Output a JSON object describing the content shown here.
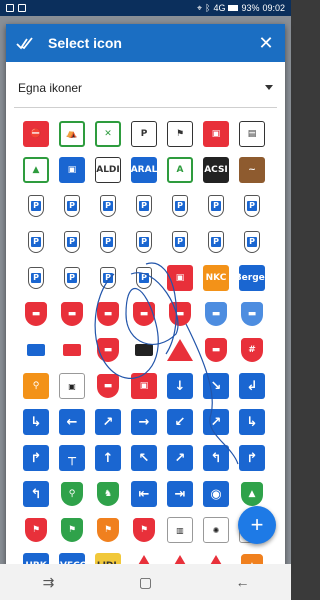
{
  "status": {
    "battery": "93%",
    "time": "09:02",
    "network": "4G"
  },
  "dialog": {
    "title": "Select icon",
    "close_glyph": "✕"
  },
  "dropdown": {
    "selected": "Egna ikoner"
  },
  "grid": {
    "icons": [
      {
        "name": "no-entry-icon",
        "cls": "red",
        "glyph": "⛔"
      },
      {
        "name": "camping-tent-icon",
        "cls": "green-tri",
        "glyph": "⛺"
      },
      {
        "name": "picnic-icon",
        "cls": "green-tri",
        "glyph": "✕"
      },
      {
        "name": "parking-caravan-icon",
        "cls": "outline",
        "glyph": "P"
      },
      {
        "name": "caravan-service-icon",
        "cls": "outline",
        "glyph": "⚑"
      },
      {
        "name": "motorhome-red-icon",
        "cls": "red",
        "glyph": "▣"
      },
      {
        "name": "motorhome-sign-icon",
        "cls": "outline",
        "glyph": "▤"
      },
      {
        "name": "camping-sign-icon",
        "cls": "green-tri",
        "glyph": "▲"
      },
      {
        "name": "motorhome-blue-icon",
        "cls": "blue",
        "glyph": "▣"
      },
      {
        "name": "aldi-icon",
        "cls": "outline",
        "glyph": "ALDI"
      },
      {
        "name": "aral-icon",
        "cls": "blue",
        "glyph": "ARAL"
      },
      {
        "name": "a-sign-icon",
        "cls": "green-tri",
        "glyph": "A"
      },
      {
        "name": "acsi-icon",
        "cls": "black",
        "glyph": "ACSI"
      },
      {
        "name": "brown-sign-icon",
        "cls": "brown",
        "glyph": "~"
      },
      {
        "name": "parking-pin-icon",
        "cls": "pinP",
        "glyph": "P"
      },
      {
        "name": "parking-pin-icon",
        "cls": "pinP",
        "glyph": "P"
      },
      {
        "name": "parking-pin-icon",
        "cls": "pinP",
        "glyph": "P"
      },
      {
        "name": "parking-pin-icon",
        "cls": "pinP",
        "glyph": "P"
      },
      {
        "name": "parking-pin-icon",
        "cls": "pinP",
        "glyph": "P"
      },
      {
        "name": "parking-pin-icon",
        "cls": "pinP",
        "glyph": "P"
      },
      {
        "name": "parking-pin-icon",
        "cls": "pinP",
        "glyph": "P"
      },
      {
        "name": "parking-pin-icon",
        "cls": "pinP",
        "glyph": "P"
      },
      {
        "name": "parking-pin-icon",
        "cls": "pinP",
        "glyph": "P"
      },
      {
        "name": "parking-pin-icon",
        "cls": "pinP",
        "glyph": "P"
      },
      {
        "name": "parking-pin-icon",
        "cls": "pinP",
        "glyph": "P"
      },
      {
        "name": "parking-pin-icon",
        "cls": "pinP",
        "glyph": "P"
      },
      {
        "name": "parking-pin-icon",
        "cls": "pinP",
        "glyph": "P"
      },
      {
        "name": "parking-pin-icon",
        "cls": "pinP",
        "glyph": "P"
      },
      {
        "name": "parking-pin-icon",
        "cls": "pinP",
        "glyph": "P"
      },
      {
        "name": "parking-pin-icon",
        "cls": "pinP",
        "glyph": "P"
      },
      {
        "name": "parking-pin-icon",
        "cls": "pinP",
        "glyph": "P"
      },
      {
        "name": "parking-pin-icon",
        "cls": "pinP",
        "glyph": "P"
      },
      {
        "name": "motorhome-red-big-icon",
        "cls": "red",
        "glyph": "▣"
      },
      {
        "name": "nkc-icon",
        "cls": "orange",
        "glyph": "NKC"
      },
      {
        "name": "berger-icon",
        "cls": "blue",
        "glyph": "Berger"
      },
      {
        "name": "motorhome-marker-red-icon",
        "cls": "markerR",
        "glyph": "▬"
      },
      {
        "name": "motorhome-marker-red-icon",
        "cls": "markerR",
        "glyph": "▬"
      },
      {
        "name": "motorhome-marker-red-icon",
        "cls": "markerR",
        "glyph": "▬"
      },
      {
        "name": "motorhome-marker-red-icon",
        "cls": "markerR",
        "glyph": "▬"
      },
      {
        "name": "motorhome-marker-red-icon",
        "cls": "markerR",
        "glyph": "▬"
      },
      {
        "name": "motorhome-marker-blue-icon",
        "cls": "markerB",
        "glyph": "▬"
      },
      {
        "name": "motorhome-marker-blue-icon",
        "cls": "markerB",
        "glyph": "▬"
      },
      {
        "name": "motorhome-small-blue-icon",
        "cls": "small",
        "glyph": ""
      },
      {
        "name": "motorhome-small-red-icon",
        "cls": "smallR",
        "glyph": ""
      },
      {
        "name": "motorhome-marker-red-icon",
        "cls": "markerR",
        "glyph": "▬"
      },
      {
        "name": "motorhome-small-black-icon",
        "cls": "smallK",
        "glyph": ""
      },
      {
        "name": "warning-sign-icon",
        "cls": "warn",
        "glyph": ""
      },
      {
        "name": "motorhome-marker-red-icon",
        "cls": "markerR",
        "glyph": "▬"
      },
      {
        "name": "fence-marker-red-icon",
        "cls": "markerR",
        "glyph": "#"
      },
      {
        "name": "cycling-icon",
        "cls": "orange",
        "glyph": "⚲"
      },
      {
        "name": "car-wreck-icon",
        "cls": "text",
        "glyph": "▣"
      },
      {
        "name": "motorhome-accident-icon",
        "cls": "markerR",
        "glyph": "▬"
      },
      {
        "name": "motorhome-sign-red-icon",
        "cls": "red",
        "glyph": "▣"
      },
      {
        "name": "arrow-down-icon",
        "cls": "blue-sign",
        "glyph": "↓"
      },
      {
        "name": "arrow-down-right-icon",
        "cls": "blue-sign",
        "glyph": "↘"
      },
      {
        "name": "turn-left-down-icon",
        "cls": "blue-sign",
        "glyph": "↲"
      },
      {
        "name": "turn-right-down-icon",
        "cls": "blue-sign",
        "glyph": "↳"
      },
      {
        "name": "arrow-left-icon",
        "cls": "blue-sign",
        "glyph": "←"
      },
      {
        "name": "arrow-up-right-icon",
        "cls": "blue-sign",
        "glyph": "↗"
      },
      {
        "name": "arrow-right-icon",
        "cls": "blue-sign",
        "glyph": "→"
      },
      {
        "name": "arrow-down-left-icon",
        "cls": "blue-sign",
        "glyph": "↙"
      },
      {
        "name": "arrow-up-right-icon",
        "cls": "blue-sign",
        "glyph": "↗"
      },
      {
        "name": "turn-right-down-icon",
        "cls": "blue-sign",
        "glyph": "↳"
      },
      {
        "name": "turn-up-right-icon",
        "cls": "blue-sign",
        "glyph": "↱"
      },
      {
        "name": "junction-t-icon",
        "cls": "blue-sign",
        "glyph": "┬"
      },
      {
        "name": "arrow-up-icon",
        "cls": "blue-sign",
        "glyph": "↑"
      },
      {
        "name": "arrow-up-left-icon",
        "cls": "blue-sign",
        "glyph": "↖"
      },
      {
        "name": "arrow-up-right-icon",
        "cls": "blue-sign",
        "glyph": "↗"
      },
      {
        "name": "turn-left-up-icon",
        "cls": "blue-sign",
        "glyph": "↰"
      },
      {
        "name": "turn-up-right-icon",
        "cls": "blue-sign",
        "glyph": "↱"
      },
      {
        "name": "return-icon",
        "cls": "blue-sign",
        "glyph": "↰"
      },
      {
        "name": "hiking-icon",
        "cls": "markerG",
        "glyph": "⚲"
      },
      {
        "name": "horse-icon",
        "cls": "markerG",
        "glyph": "♞"
      },
      {
        "name": "exit-left-icon",
        "cls": "blue-sign",
        "glyph": "⇤"
      },
      {
        "name": "exit-right-icon",
        "cls": "blue-sign",
        "glyph": "⇥"
      },
      {
        "name": "camera-icon",
        "cls": "blue-sign",
        "glyph": "◉"
      },
      {
        "name": "mountain-marker-icon",
        "cls": "markerG",
        "glyph": "▲"
      },
      {
        "name": "finish-red-icon",
        "cls": "markerR",
        "glyph": "⚑"
      },
      {
        "name": "finish-green-icon",
        "cls": "markerG",
        "glyph": "⚑"
      },
      {
        "name": "finish-orange-icon",
        "cls": "markerO",
        "glyph": "⚑"
      },
      {
        "name": "finish-red-icon",
        "cls": "markerR",
        "glyph": "⚑"
      },
      {
        "name": "gas-cylinder-icon",
        "cls": "text",
        "glyph": "▥"
      },
      {
        "name": "sunflower-icon",
        "cls": "text",
        "glyph": "✺"
      },
      {
        "name": "blank-icon",
        "cls": "text",
        "glyph": ""
      },
      {
        "name": "hbk-icon",
        "cls": "blue",
        "glyph": "HBK"
      },
      {
        "name": "iveco-icon",
        "cls": "blue",
        "glyph": "IVECO"
      },
      {
        "name": "lidl-icon",
        "cls": "yellow",
        "glyph": "LIDL"
      },
      {
        "name": "warning-triangle-icon",
        "cls": "warn",
        "glyph": ""
      },
      {
        "name": "warning-triangle-icon",
        "cls": "warn",
        "glyph": ""
      },
      {
        "name": "warning-triangle-icon",
        "cls": "warn",
        "glyph": ""
      },
      {
        "name": "mountain-marker-orange-icon",
        "cls": "markerO",
        "glyph": "▲"
      }
    ]
  },
  "fab": {
    "glyph": "+"
  },
  "nav": {
    "recent": "⇉",
    "home": "▢",
    "back": "←"
  }
}
